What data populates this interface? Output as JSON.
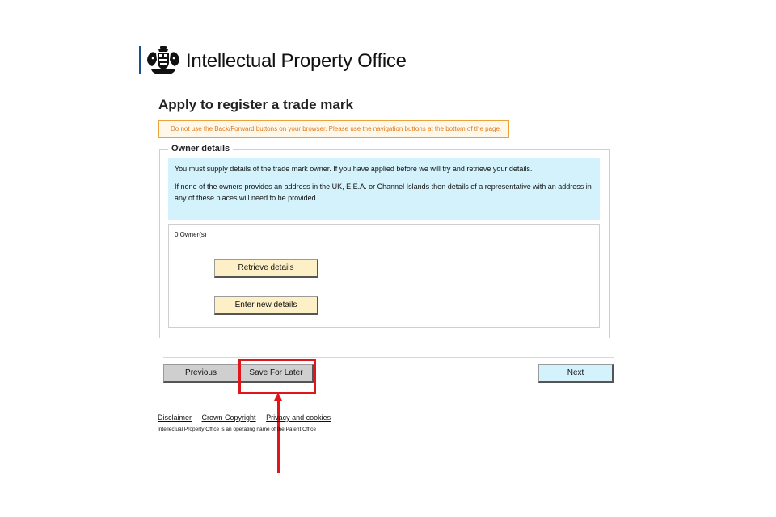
{
  "header": {
    "brand": "Intellectual Property Office",
    "crest_icon": "royal-coat-of-arms-icon",
    "accent_color": "#1a4f8a"
  },
  "page": {
    "title": "Apply to register a trade mark"
  },
  "warning": {
    "text": "Do not use the Back/Forward buttons on your browser. Please use the navigation buttons at the bottom of the page.",
    "color": "#e07a1e"
  },
  "owner_details": {
    "legend": "Owner details",
    "info_paragraph_1": "You must supply details of the trade mark owner. If you have applied before we will try and retrieve your details.",
    "info_paragraph_2": "If none of the owners provides an address in the UK, E.E.A. or Channel Islands then details of a representative with an address in any of these places will need to be provided.",
    "owner_count": "0 Owner(s)",
    "retrieve_label": "Retrieve details",
    "enter_new_label": "Enter new details"
  },
  "navigation": {
    "previous_label": "Previous",
    "save_label": "Save For Later",
    "next_label": "Next"
  },
  "annotation": {
    "highlight_color": "#e0161b"
  },
  "footer": {
    "links": [
      "Disclaimer",
      "Crown Copyright",
      "Privacy and cookies"
    ],
    "note": "Intellectual Property Office is an operating name of the Patent Office"
  }
}
